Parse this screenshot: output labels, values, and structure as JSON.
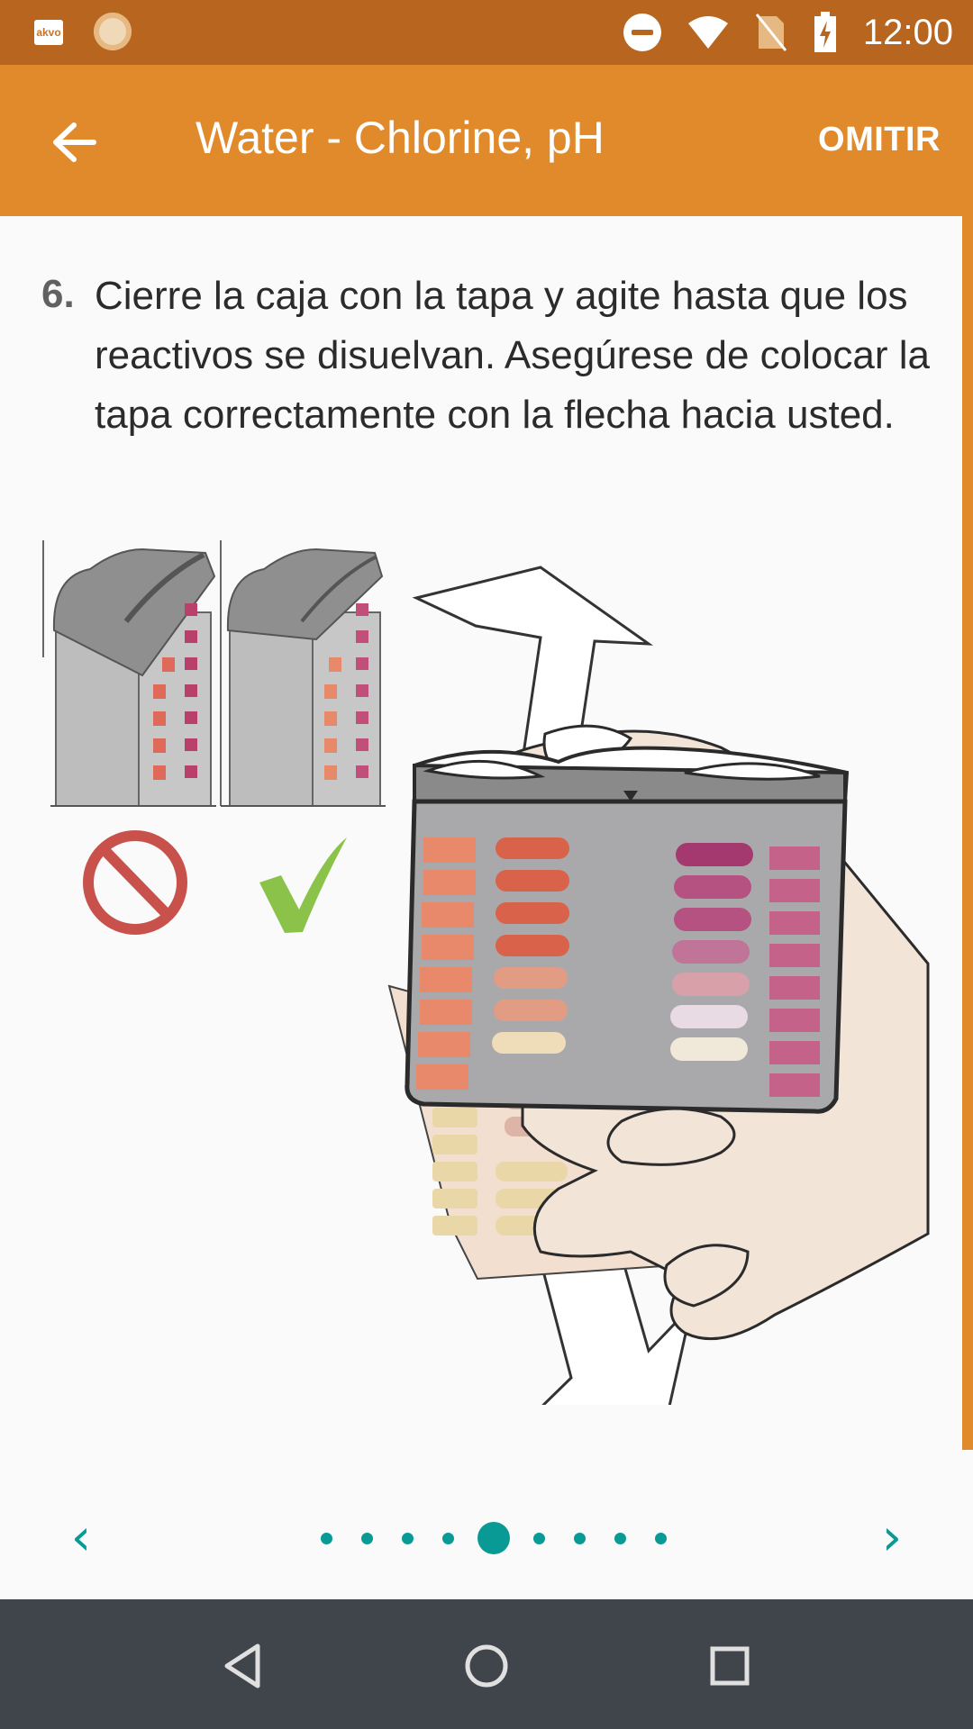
{
  "status_bar": {
    "app_icon_label": "akvo",
    "time": "12:00"
  },
  "app_bar": {
    "title": "Water - Chlorine, pH",
    "skip_label": "OMITIR"
  },
  "instruction": {
    "number": "6.",
    "text": "Cierre la caja con la tapa y agite hasta que los reactivos se disuelvan. Asegúrese de colocar la tapa correctamente con la flecha hacia usted."
  },
  "pager": {
    "prev_glyph": "‹",
    "next_glyph": "›",
    "total_pages": 9,
    "current_page": 5
  },
  "colors": {
    "status_bar": "#b8651f",
    "app_bar": "#e08a2b",
    "accent": "#0a9a95",
    "nav_bar": "#3f454a"
  }
}
